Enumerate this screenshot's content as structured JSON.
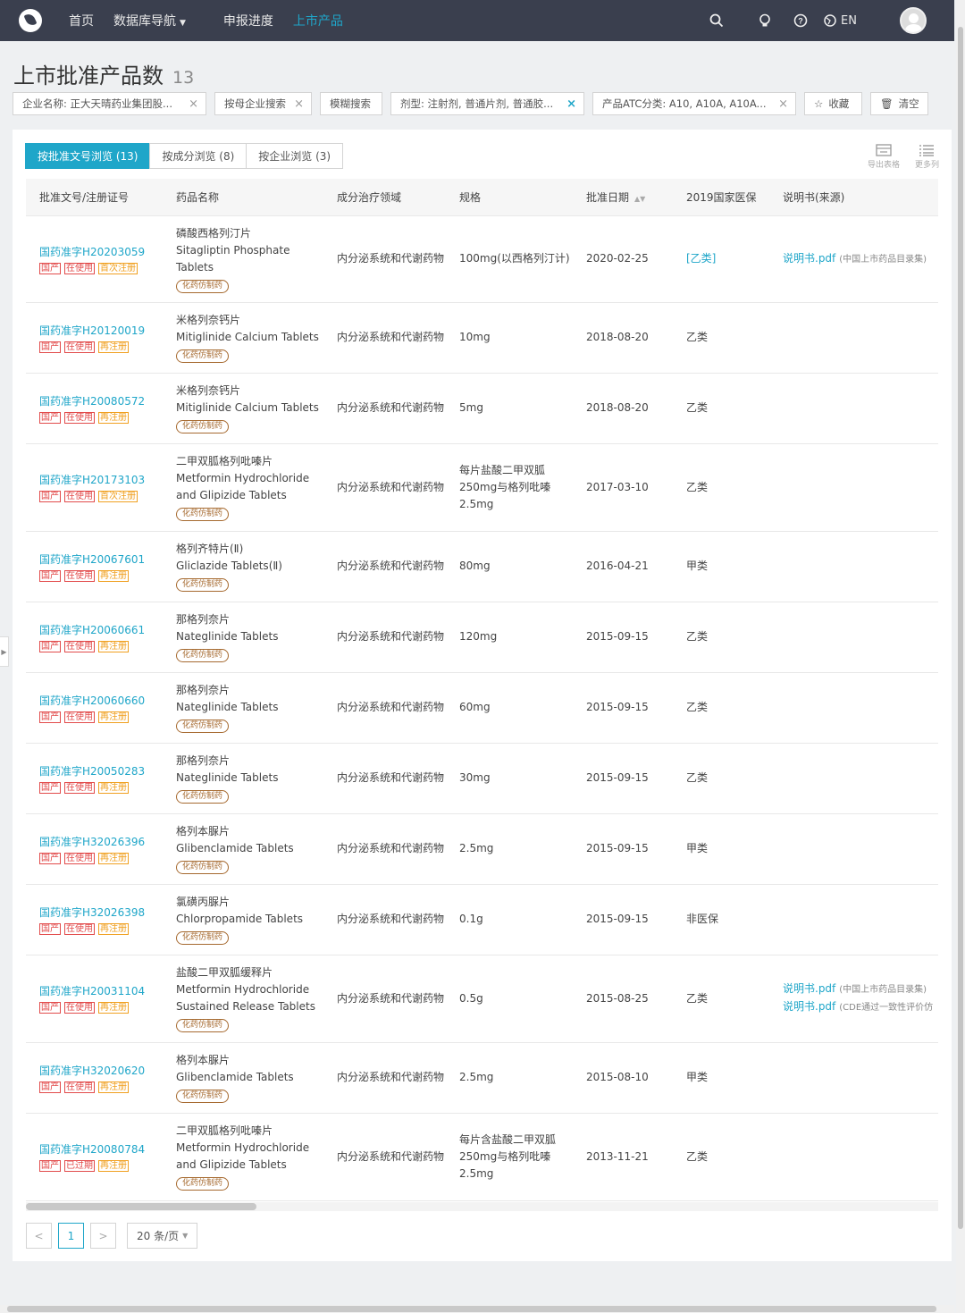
{
  "nav": {
    "home": "首页",
    "database_nav": "数据库导航",
    "progress": "申报进度",
    "market_products": "上市产品",
    "lang": "EN"
  },
  "page": {
    "title": "上市批准产品数",
    "count": "13"
  },
  "filters": {
    "company": "企业名称: 正大天晴药业集团股...",
    "parent_search": "按母企业搜索",
    "fuzzy": "模糊搜索",
    "dosage": "剂型: 注射剂, 普通片剂, 普通胶...",
    "atc": "产品ATC分类: A10, A10A, A10A...",
    "favorite": "收藏",
    "clear": "清空"
  },
  "tabs": [
    {
      "label": "按批准文号浏览 (13)"
    },
    {
      "label": "按成分浏览 (8)"
    },
    {
      "label": "按企业浏览 (3)"
    }
  ],
  "tools": {
    "export": "导出表格",
    "more_columns": "更多列"
  },
  "columns": {
    "approval": "批准文号/注册证号",
    "drug_name": "药品名称",
    "therapy_area": "成分治疗领域",
    "spec": "规格",
    "approval_date": "批准日期",
    "insurance": "2019国家医保",
    "manual": "说明书(来源)"
  },
  "rows": [
    {
      "approval": "国药准字H20203059",
      "b1": "国产",
      "b2": "在使用",
      "b3": "首次注册",
      "cn": "磷酸西格列汀片",
      "en": "Sitagliptin Phosphate Tablets",
      "tag": "化药仿制药",
      "area": "内分泌系统和代谢药物",
      "spec": "100mg(以西格列汀计)",
      "date": "2020-02-25",
      "ins": "[乙类]",
      "m1": "说明书.pdf",
      "m1src": "(中国上市药品目录集)",
      "m2": "",
      "m2src": ""
    },
    {
      "approval": "国药准字H20120019",
      "b1": "国产",
      "b2": "在使用",
      "b3": "再注册",
      "cn": "米格列奈钙片",
      "en": "Mitiglinide Calcium Tablets",
      "tag": "化药仿制药",
      "area": "内分泌系统和代谢药物",
      "spec": "10mg",
      "date": "2018-08-20",
      "ins": "乙类",
      "m1": "",
      "m1src": "",
      "m2": "",
      "m2src": ""
    },
    {
      "approval": "国药准字H20080572",
      "b1": "国产",
      "b2": "在使用",
      "b3": "再注册",
      "cn": "米格列奈钙片",
      "en": "Mitiglinide Calcium Tablets",
      "tag": "化药仿制药",
      "area": "内分泌系统和代谢药物",
      "spec": "5mg",
      "date": "2018-08-20",
      "ins": "乙类",
      "m1": "",
      "m1src": "",
      "m2": "",
      "m2src": ""
    },
    {
      "approval": "国药准字H20173103",
      "b1": "国产",
      "b2": "在使用",
      "b3": "首次注册",
      "cn": "二甲双胍格列吡嗪片",
      "en": "Metformin Hydrochloride and Glipizide Tablets",
      "tag": "化药仿制药",
      "area": "内分泌系统和代谢药物",
      "spec": "每片盐酸二甲双胍250mg与格列吡嗪2.5mg",
      "date": "2017-03-10",
      "ins": "乙类",
      "m1": "",
      "m1src": "",
      "m2": "",
      "m2src": ""
    },
    {
      "approval": "国药准字H20067601",
      "b1": "国产",
      "b2": "在使用",
      "b3": "再注册",
      "cn": "格列齐特片(Ⅱ)",
      "en": "Gliclazide Tablets(Ⅱ)",
      "tag": "化药仿制药",
      "area": "内分泌系统和代谢药物",
      "spec": "80mg",
      "date": "2016-04-21",
      "ins": "甲类",
      "m1": "",
      "m1src": "",
      "m2": "",
      "m2src": ""
    },
    {
      "approval": "国药准字H20060661",
      "b1": "国产",
      "b2": "在使用",
      "b3": "再注册",
      "cn": "那格列奈片",
      "en": "Nateglinide Tablets",
      "tag": "化药仿制药",
      "area": "内分泌系统和代谢药物",
      "spec": "120mg",
      "date": "2015-09-15",
      "ins": "乙类",
      "m1": "",
      "m1src": "",
      "m2": "",
      "m2src": ""
    },
    {
      "approval": "国药准字H20060660",
      "b1": "国产",
      "b2": "在使用",
      "b3": "再注册",
      "cn": "那格列奈片",
      "en": "Nateglinide Tablets",
      "tag": "化药仿制药",
      "area": "内分泌系统和代谢药物",
      "spec": "60mg",
      "date": "2015-09-15",
      "ins": "乙类",
      "m1": "",
      "m1src": "",
      "m2": "",
      "m2src": ""
    },
    {
      "approval": "国药准字H20050283",
      "b1": "国产",
      "b2": "在使用",
      "b3": "再注册",
      "cn": "那格列奈片",
      "en": "Nateglinide Tablets",
      "tag": "化药仿制药",
      "area": "内分泌系统和代谢药物",
      "spec": "30mg",
      "date": "2015-09-15",
      "ins": "乙类",
      "m1": "",
      "m1src": "",
      "m2": "",
      "m2src": ""
    },
    {
      "approval": "国药准字H32026396",
      "b1": "国产",
      "b2": "在使用",
      "b3": "再注册",
      "cn": "格列本脲片",
      "en": "Glibenclamide Tablets",
      "tag": "化药仿制药",
      "area": "内分泌系统和代谢药物",
      "spec": "2.5mg",
      "date": "2015-09-15",
      "ins": "甲类",
      "m1": "",
      "m1src": "",
      "m2": "",
      "m2src": ""
    },
    {
      "approval": "国药准字H32026398",
      "b1": "国产",
      "b2": "在使用",
      "b3": "再注册",
      "cn": "氯磺丙脲片",
      "en": "Chlorpropamide Tablets",
      "tag": "化药仿制药",
      "area": "内分泌系统和代谢药物",
      "spec": "0.1g",
      "date": "2015-09-15",
      "ins": "非医保",
      "m1": "",
      "m1src": "",
      "m2": "",
      "m2src": ""
    },
    {
      "approval": "国药准字H20031104",
      "b1": "国产",
      "b2": "在使用",
      "b3": "再注册",
      "cn": "盐酸二甲双胍缓释片",
      "en": "Metformin Hydrochloride Sustained Release Tablets",
      "tag": "化药仿制药",
      "area": "内分泌系统和代谢药物",
      "spec": "0.5g",
      "date": "2015-08-25",
      "ins": "乙类",
      "m1": "说明书.pdf",
      "m1src": "(中国上市药品目录集)",
      "m2": "说明书.pdf",
      "m2src": "(CDE通过一致性评价仿"
    },
    {
      "approval": "国药准字H32020620",
      "b1": "国产",
      "b2": "在使用",
      "b3": "再注册",
      "cn": "格列本脲片",
      "en": "Glibenclamide Tablets",
      "tag": "化药仿制药",
      "area": "内分泌系统和代谢药物",
      "spec": "2.5mg",
      "date": "2015-08-10",
      "ins": "甲类",
      "m1": "",
      "m1src": "",
      "m2": "",
      "m2src": ""
    },
    {
      "approval": "国药准字H20080784",
      "b1": "国产",
      "b2": "已过期",
      "b3": "再注册",
      "cn": "二甲双胍格列吡嗪片",
      "en": "Metformin Hydrochloride and Glipizide Tablets",
      "tag": "化药仿制药",
      "area": "内分泌系统和代谢药物",
      "spec": "每片含盐酸二甲双胍250mg与格列吡嗪2.5mg",
      "date": "2013-11-21",
      "ins": "乙类",
      "m1": "",
      "m1src": "",
      "m2": "",
      "m2src": ""
    }
  ],
  "pagination": {
    "prev": "<",
    "current": "1",
    "next": ">",
    "page_size": "20 条/页"
  },
  "colors": {
    "accent": "#1fa6c9",
    "topbar": "#3a3f4e",
    "badge_red": "#e24b4b",
    "badge_orange": "#f0a020"
  }
}
